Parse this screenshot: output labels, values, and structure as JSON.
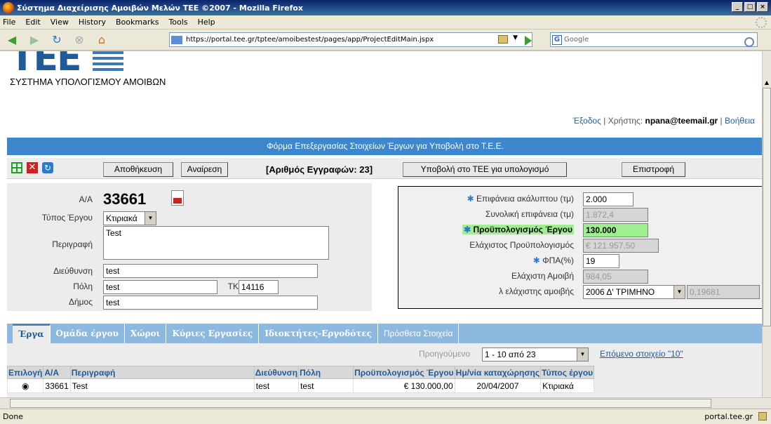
{
  "window": {
    "title": "Σύστημα Διαχείρισης Αμοιβών Μελών ΤΕΕ ©2007 - Mozilla Firefox"
  },
  "menu": [
    "File",
    "Edit",
    "View",
    "History",
    "Bookmarks",
    "Tools",
    "Help"
  ],
  "nav": {
    "url": "https://portal.tee.gr/tptee/amoibestest/pages/app/ProjectEditMain.jspx",
    "search_placeholder": "Google"
  },
  "header": {
    "logo_text": "TEE",
    "system_title": "ΣΥΣΤΗΜΑ ΥΠΟΛΟΓΙΣΜΟΥ ΑΜΟΙΒΩΝ",
    "logout": "Έξοδος",
    "user_label": "Χρήστης:",
    "user": "npana@teemail.gr",
    "help": "Βοήθεια"
  },
  "form_title": "Φόρμα Επεξεργασίας Στοιχείων Έργων για Υποβολή στο Τ.Ε.Ε.",
  "toolbar": {
    "save": "Αποθήκευση",
    "search": "Αναίρεση",
    "record_count": "[Αριθμός Εγγραφών: 23]",
    "submit": "Υποβολή στο ΤΕΕ για υπολογισμό",
    "back": "Επιστροφή"
  },
  "left": {
    "aa_label": "Α/Α",
    "aa_value": "33661",
    "type_label": "Τύπος Έργου",
    "type_value": "Κτιριακά",
    "desc_label": "Περιγραφή",
    "desc_value": "Test",
    "address_label": "Διεύθυνση",
    "address_value": "test",
    "city_label": "Πόλη",
    "city_value": "test",
    "tk_label": "ΤΚ",
    "tk_value": "14116",
    "municipality_label": "Δήμος",
    "municipality_value": "test"
  },
  "right": {
    "plot_label": "Επιφάνεια ακάλυπτου (τμ)",
    "plot_value": "2.000",
    "total_area_label": "Συνολική επιφάνεια (τμ)",
    "total_area_value": "1.872,4",
    "budget_label": "Προϋπολογισμός Έργου",
    "budget_value": "130.000",
    "min_budget_label": "Ελάχιστος Προϋπολογισμός",
    "min_budget_value": "€ 121.957,50",
    "vat_label": "ΦΠΑ(%)",
    "vat_value": "19",
    "min_fee_label": "Ελάχιστη Αμοιβή",
    "min_fee_value": "984,05",
    "lambda_label": "λ ελάχιστης αμοιβής",
    "lambda_period": "2006 Δ' ΤΡΙΜΗΝΟ",
    "lambda_value": "0,19681"
  },
  "tabs": [
    "Έργα",
    "Ομάδα έργου",
    "Χώροι",
    "Κύριες Εργασίες",
    "Ιδιοκτήτες-Εργοδότες",
    "Πρόσθετα Στοιχεία"
  ],
  "pager": {
    "prev": "Προηγούμενο",
    "range": "1 - 10 από 23",
    "next": "Επόμενο στοιχείο \"10\""
  },
  "table": {
    "headers": [
      "Επιλογή",
      "Α/Α",
      "Περιγραφή",
      "Διεύθυνση",
      "Πόλη",
      "Προϋπολογισμός Έργου",
      "Ημ/νία καταχώρησης",
      "Τύπος έργου"
    ],
    "rows": [
      [
        "◉",
        "33661",
        "Test",
        "test",
        "test",
        "€ 130.000,00",
        "20/04/2007",
        "Κτιριακά"
      ]
    ]
  },
  "status": {
    "left": "Done",
    "right": "portal.tee.gr"
  }
}
